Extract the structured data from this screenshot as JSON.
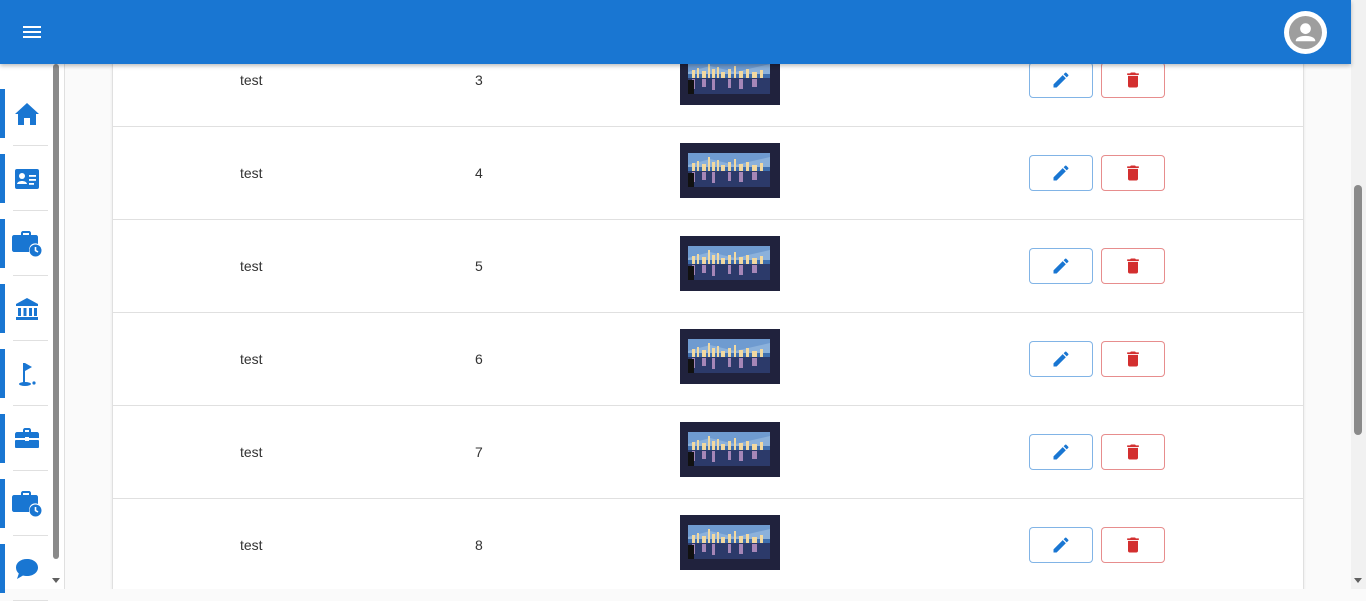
{
  "header": {
    "menu_icon": "menu-icon",
    "avatar_icon": "account-circle-icon",
    "color": "#1976d2"
  },
  "sidebar": {
    "items": [
      {
        "id": "home",
        "icon": "home-icon"
      },
      {
        "id": "contact-card",
        "icon": "contact-card-icon"
      },
      {
        "id": "work-history",
        "icon": "briefcase-clock-icon"
      },
      {
        "id": "bank",
        "icon": "bank-icon"
      },
      {
        "id": "golf",
        "icon": "golf-flag-icon"
      },
      {
        "id": "work",
        "icon": "briefcase-icon"
      },
      {
        "id": "work-schedule",
        "icon": "briefcase-clock-icon"
      },
      {
        "id": "chat",
        "icon": "chat-bubble-icon"
      }
    ]
  },
  "table": {
    "rows": [
      {
        "name": "test",
        "number": "3"
      },
      {
        "name": "test",
        "number": "4"
      },
      {
        "name": "test",
        "number": "5"
      },
      {
        "name": "test",
        "number": "6"
      },
      {
        "name": "test",
        "number": "7"
      },
      {
        "name": "test",
        "number": "8"
      }
    ],
    "edit_icon": "pencil-icon",
    "delete_icon": "trash-icon",
    "edit_color": "#1976d2",
    "delete_color": "#d32f2f"
  }
}
